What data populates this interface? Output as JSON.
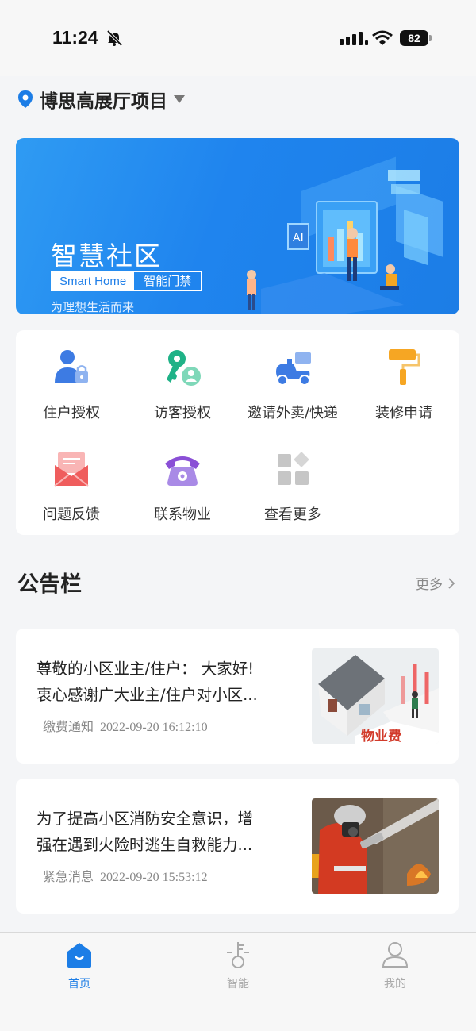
{
  "status_bar": {
    "time": "11:24",
    "battery": "82"
  },
  "header": {
    "location_name": "博思高展厅项目"
  },
  "banner": {
    "title": "智慧社区",
    "tag_primary": "Smart Home",
    "tag_secondary": "智能门禁",
    "subtitle": "为理想生活而来"
  },
  "functions": [
    {
      "label": "住户授权",
      "icon": "resident-auth-icon"
    },
    {
      "label": "访客授权",
      "icon": "visitor-key-icon"
    },
    {
      "label": "邀请外卖/快递",
      "icon": "delivery-scooter-icon"
    },
    {
      "label": "装修申请",
      "icon": "paint-roller-icon"
    },
    {
      "label": "问题反馈",
      "icon": "feedback-envelope-icon"
    },
    {
      "label": "联系物业",
      "icon": "telephone-icon"
    },
    {
      "label": "查看更多",
      "icon": "more-grid-icon"
    }
  ],
  "notices": {
    "title": "公告栏",
    "more_label": "更多",
    "items": [
      {
        "line1": "尊敬的小区业主/住户： 大家好!",
        "line2": "衷心感谢广大业主/住户对小区...",
        "category": "缴费通知",
        "timestamp": "2022-09-20 16:12:10",
        "thumb_text": "物业费"
      },
      {
        "line1": "为了提高小区消防安全意识，增",
        "line2": "强在遇到火险时逃生自救能力...",
        "category": "紧急消息",
        "timestamp": "2022-09-20 15:53:12"
      }
    ]
  },
  "tabbar": {
    "tabs": [
      {
        "label": "首页",
        "icon": "home-icon",
        "active": true
      },
      {
        "label": "智能",
        "icon": "smart-key-icon",
        "active": false
      },
      {
        "label": "我的",
        "icon": "profile-icon",
        "active": false
      }
    ]
  },
  "colors": {
    "accent": "#1c7de6",
    "background": "#f4f5f7"
  }
}
